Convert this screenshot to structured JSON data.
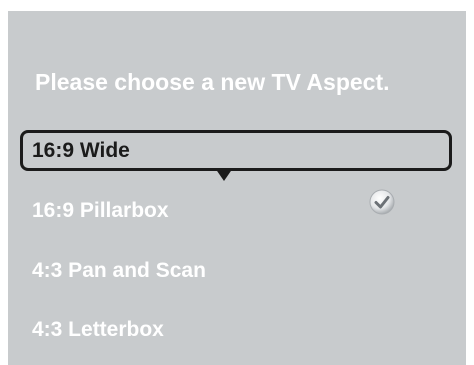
{
  "dialog": {
    "title": "Please choose a new TV Aspect.",
    "options": [
      {
        "label": "16:9 Wide",
        "state": "focused"
      },
      {
        "label": "16:9 Pillarbox",
        "state": "checked"
      },
      {
        "label": "4:3 Pan and Scan",
        "state": "normal"
      },
      {
        "label": "4:3 Letterbox",
        "state": "normal"
      }
    ],
    "icons": {
      "checkmark": "checkmark-icon",
      "focus_indicator": "caret-down-icon"
    }
  },
  "colors": {
    "panel_background": "#c8cbcd",
    "text": "#ffffff",
    "focus": "#1b1b1b"
  }
}
